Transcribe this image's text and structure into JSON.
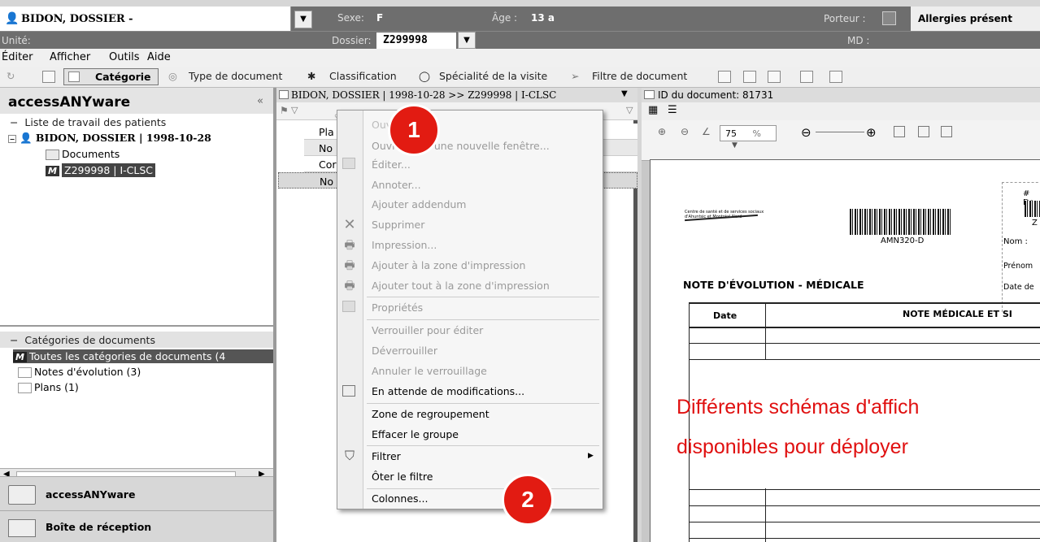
{
  "header": {
    "patient_name": "BIDON, DOSSIER -",
    "sex_label": "Sexe:",
    "sex_value": "F",
    "age_label": "Âge :",
    "age_value": "13 a",
    "carrier_label": "Porteur :",
    "allergies": "Allergies présent",
    "unit_label": "Unité:",
    "dossier_label": "Dossier:",
    "dossier_value": "Z299998",
    "md_label": "MD :"
  },
  "menubar": [
    "Éditer",
    "Afficher",
    "Outils",
    "Aide"
  ],
  "toolbar": {
    "categorie": "Catégorie",
    "type_document": "Type de document",
    "classification": "Classification",
    "specialite": "Spécialité de la visite",
    "filtre": "Filtre de document"
  },
  "left": {
    "title": "accessANYware",
    "collapse": "«",
    "worklist": "Liste de travail des patients",
    "patient": "BIDON, DOSSIER | 1998-10-28",
    "documents": "Documents",
    "dossier_node": "Z299998 | I-CLSC",
    "categories_header": "Catégories de documents",
    "cat_all": "Toutes les catégories de documents (4",
    "cat_notes": "Notes d'évolution (3)",
    "cat_plans": "Plans (1)",
    "nav_a": "accessANYware",
    "nav_b": "Boîte de réception"
  },
  "middle": {
    "breadcrumb": "BIDON, DOSSIER | 1998-10-28 >> Z299998 | I-CLSC",
    "rows": [
      "Pla",
      "No",
      "Cor",
      "No"
    ]
  },
  "context_menu": {
    "items": [
      {
        "label": "Ouvrir",
        "enabled": true
      },
      {
        "label": "Ouvrir dans une nouvelle fenêtre...",
        "enabled": false
      },
      {
        "label": "Éditer...",
        "enabled": false
      },
      {
        "label": "Annoter...",
        "enabled": false
      },
      {
        "label": "Ajouter addendum",
        "enabled": false
      },
      {
        "label": "Supprimer",
        "enabled": false
      },
      {
        "label": "Impression...",
        "enabled": false
      },
      {
        "label": "Ajouter à la zone d'impression",
        "enabled": false
      },
      {
        "label": "Ajouter tout à la zone d'impression",
        "enabled": false
      },
      {
        "label": "Propriétés",
        "enabled": false
      },
      {
        "label": "Verrouiller pour éditer",
        "enabled": false
      },
      {
        "label": "Déverrouiller",
        "enabled": false
      },
      {
        "label": "Annuler le verrouillage",
        "enabled": false
      },
      {
        "label": "En attende de modifications...",
        "enabled": true
      },
      {
        "label": "Zone de regroupement",
        "enabled": true
      },
      {
        "label": "Effacer le groupe",
        "enabled": true
      },
      {
        "label": "Filtrer",
        "enabled": true
      },
      {
        "label": "Ôter le filtre",
        "enabled": true
      },
      {
        "label": "Colonnes...",
        "enabled": true
      }
    ]
  },
  "viewer": {
    "doc_id": "ID du document: 81731",
    "zoom": "75",
    "zoom_unit": "%",
    "org_line1": "Centre de santé et de services sociaux",
    "org_line2": "d'Ahuntsic et Montréal-Nord",
    "barcode_label": "AMN320-D",
    "doc_num": "# Do",
    "z_code": "Z",
    "nom": "Nom :",
    "prenom": "Prénom",
    "date_de": "Date de",
    "form_title": "NOTE D'ÉVOLUTION - MÉDICALE",
    "col_date": "Date",
    "col_note": "NOTE MÉDICALE ET SI"
  },
  "annotations": {
    "badge1": "1",
    "badge2": "2",
    "text_line1": "Différents schémas d'affich",
    "text_line2": "disponibles pour  déployer"
  },
  "colors": {
    "annotation_red": "#e21b12",
    "header_gray": "#6e6e6e"
  }
}
